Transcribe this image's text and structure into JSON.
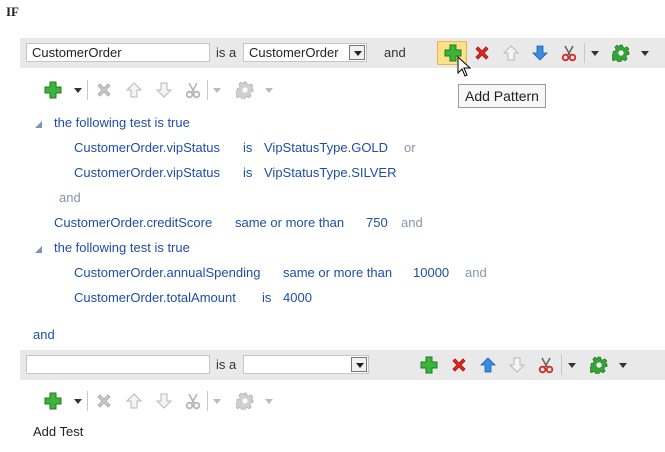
{
  "rule": {
    "if_label": "IF"
  },
  "pattern1": {
    "variable_value": "CustomerOrder",
    "is_a_label": "is a",
    "type_value": "CustomerOrder",
    "and_label": "and",
    "tooltip": "Add Pattern",
    "tests": [
      {
        "kind": "group",
        "label": "the following test is true"
      },
      {
        "left": "CustomerOrder.vipStatus",
        "op": "is",
        "right": "VipStatusType.GOLD",
        "connector": "or"
      },
      {
        "left": "CustomerOrder.vipStatus",
        "op": "is",
        "right": "VipStatusType.SILVER"
      },
      {
        "kind": "connector",
        "label": "and"
      },
      {
        "left": "CustomerOrder.creditScore",
        "op": "same or more than",
        "right": "750",
        "connector": "and"
      },
      {
        "kind": "group",
        "label": "the following test is true"
      },
      {
        "left": "CustomerOrder.annualSpending",
        "op": "same or more than",
        "right": "10000",
        "connector": "and"
      },
      {
        "left": "CustomerOrder.totalAmount",
        "op": "is",
        "right": "4000"
      }
    ]
  },
  "between_patterns": {
    "and_label": "and"
  },
  "pattern2": {
    "variable_value": "",
    "is_a_label": "is a",
    "type_value": "",
    "add_test_label": "Add Test"
  },
  "icons": {
    "add": "add-icon",
    "delete": "delete-icon",
    "move_up": "arrow-up-icon",
    "move_down": "arrow-down-icon",
    "cut": "scissors-icon",
    "settings": "gear-icon"
  },
  "colors": {
    "add_green": "#2fa82f",
    "delete_red": "#d9261c",
    "arrow_blue": "#2a78d4",
    "link_blue": "#1e4ea8",
    "connector_gray": "#8795ae"
  }
}
